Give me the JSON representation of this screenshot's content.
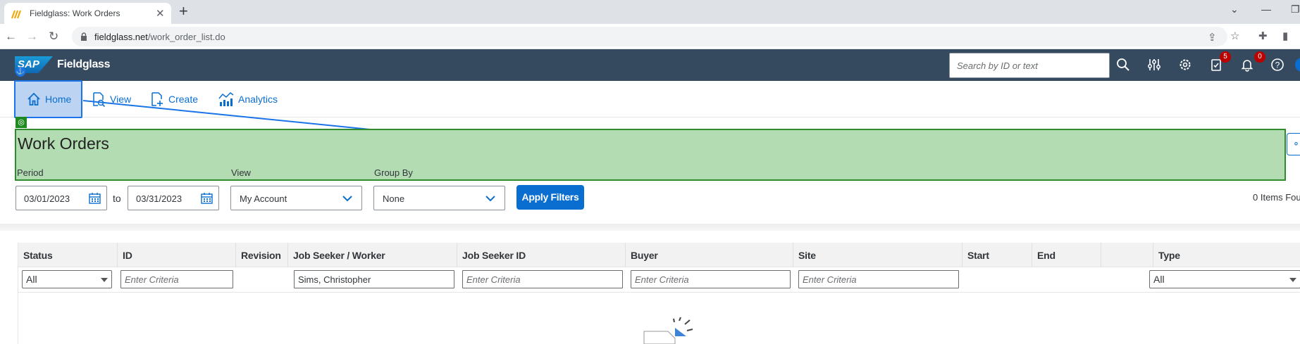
{
  "browser": {
    "tab_title": "Fieldglass: Work Orders",
    "url_host": "fieldglass.net",
    "url_path": "/work_order_list.do"
  },
  "shell": {
    "logo_text": "SAP",
    "brand": "Fieldglass",
    "search_placeholder": "Search by ID or text",
    "badges": {
      "tasks": "5",
      "notifications": "0"
    }
  },
  "nav": {
    "items": [
      {
        "label": "Home"
      },
      {
        "label": "View"
      },
      {
        "label": "Create"
      },
      {
        "label": "Analytics"
      }
    ]
  },
  "page": {
    "title": "Work Orders",
    "period_label": "Period",
    "view_label": "View",
    "group_by_label": "Group By",
    "date_from": "03/01/2023",
    "to_label": "to",
    "date_to": "03/31/2023",
    "view_value": "My Account",
    "group_by_value": "None",
    "apply_label": "Apply Filters",
    "items_found": "0 Items Fou"
  },
  "table": {
    "columns": [
      "Status",
      "ID",
      "Revision",
      "Job Seeker / Worker",
      "Job Seeker ID",
      "Buyer",
      "Site",
      "Start",
      "End",
      "",
      "Type"
    ],
    "filters": {
      "status": "All",
      "id_placeholder": "Enter Criteria",
      "worker": "Sims, Christopher",
      "seeker_id_placeholder": "Enter Criteria",
      "buyer_placeholder": "Enter Criteria",
      "site_placeholder": "Enter Criteria",
      "type": "All"
    }
  },
  "colors": {
    "shell_bg": "#354a5f",
    "accent": "#0a6ed1",
    "highlight_green": "#b3dcb3"
  }
}
